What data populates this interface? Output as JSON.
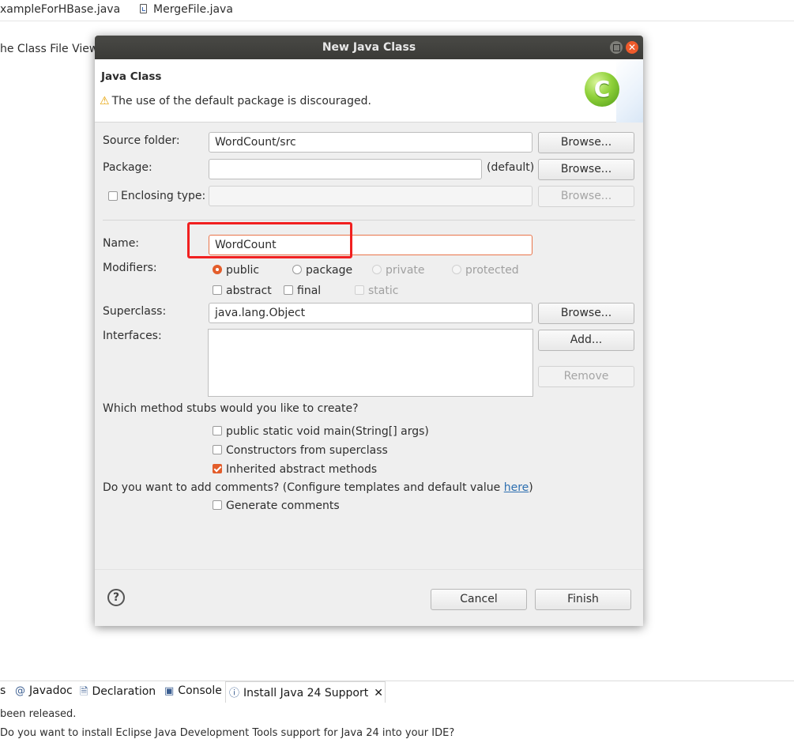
{
  "editor": {
    "tabs": [
      {
        "label": "xampleForHBase.java"
      },
      {
        "label": "MergeFile.java"
      }
    ],
    "content_text": "he Class File Viewe"
  },
  "bottom_panel": {
    "tabs": [
      {
        "label": "s"
      },
      {
        "label": "Javadoc",
        "icon": "at-icon"
      },
      {
        "label": "Declaration",
        "icon": "declaration-icon"
      },
      {
        "label": "Console",
        "icon": "console-icon"
      },
      {
        "label": "Install Java 24 Support",
        "icon": "info-icon"
      }
    ],
    "message_1": "been released.",
    "message_2": "Do you want to install Eclipse Java Development Tools support for Java 24 into your IDE?"
  },
  "dialog": {
    "title": "New Java Class",
    "header": {
      "title": "Java Class",
      "warning": "The use of the default package is discouraged."
    },
    "source_folder": {
      "label": "Source folder:",
      "value": "WordCount/src",
      "browse": "Browse..."
    },
    "package": {
      "label": "Package:",
      "value": "",
      "default_label": "(default)",
      "browse": "Browse..."
    },
    "enclosing": {
      "label": "Enclosing type:",
      "value": "",
      "browse": "Browse...",
      "checked": false
    },
    "name": {
      "label": "Name:",
      "value": "WordCount"
    },
    "modifiers": {
      "label": "Modifiers:",
      "access": [
        {
          "label": "public",
          "selected": true
        },
        {
          "label": "package",
          "selected": false
        },
        {
          "label": "private",
          "disabled": true
        },
        {
          "label": "protected",
          "disabled": true
        }
      ],
      "flags": [
        {
          "label": "abstract",
          "checked": false
        },
        {
          "label": "final",
          "checked": false
        },
        {
          "label": "static",
          "disabled": true
        }
      ]
    },
    "superclass": {
      "label": "Superclass:",
      "value": "java.lang.Object",
      "browse": "Browse..."
    },
    "interfaces": {
      "label": "Interfaces:",
      "add": "Add...",
      "remove": "Remove"
    },
    "stubs": {
      "question": "Which method stubs would you like to create?",
      "options": [
        {
          "label": "public static void main(String[] args)",
          "checked": false
        },
        {
          "label": "Constructors from superclass",
          "checked": false
        },
        {
          "label": "Inherited abstract methods",
          "checked": true
        }
      ]
    },
    "comments": {
      "question_prefix": "Do you want to add comments? (Configure templates and default value ",
      "link": "here",
      "question_suffix": ")",
      "option": "Generate comments",
      "checked": false
    },
    "help_symbol": "?",
    "cancel": "Cancel",
    "finish": "Finish",
    "colors": {
      "accent": "#e35d2b",
      "highlight": "#f12020",
      "titlebar": "#3f3f3c"
    }
  }
}
